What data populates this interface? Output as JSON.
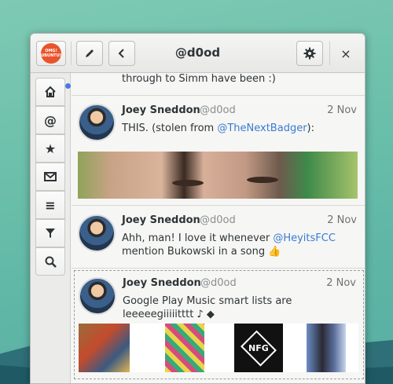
{
  "window": {
    "title": "@d0od",
    "logo_lines": [
      "OMG!",
      "UBUNTU!"
    ]
  },
  "colors": {
    "accent": "#3b7bd1",
    "logo": "#e9542b",
    "notification": "#4a79e6"
  },
  "header": {
    "icons": [
      "omg-logo",
      "compose-icon",
      "back-icon",
      "gear-icon",
      "close-icon"
    ],
    "close_label": "×"
  },
  "sidebar": {
    "items": [
      {
        "icon": "home-icon",
        "glyph": "⌂",
        "notification": true
      },
      {
        "icon": "mentions-icon",
        "glyph": "@"
      },
      {
        "icon": "favorites-icon",
        "glyph": "★"
      },
      {
        "icon": "messages-icon",
        "glyph": "✉"
      },
      {
        "icon": "lists-icon",
        "glyph": "≡"
      },
      {
        "icon": "filters-icon",
        "glyph": "⏷"
      },
      {
        "icon": "search-icon",
        "glyph": "⌕"
      }
    ]
  },
  "feed": {
    "fragment": "through to Simm have been :)",
    "tweets": [
      {
        "name": "Joey Sneddon",
        "handle": "@d0od",
        "date": "2 Nov",
        "text_before": "THIS. (stolen from ",
        "link": "@TheNextBadger",
        "text_after": "):"
      },
      {
        "name": "Joey Sneddon",
        "handle": "@d0od",
        "date": "2 Nov",
        "text_before": "Ahh, man! I love it whenever ",
        "link": "@HeyitsFCC",
        "text_after": " mention Bukowski in a song 👍"
      },
      {
        "name": "Joey Sneddon",
        "handle": "@d0od",
        "date": "2 Nov",
        "text": "Google Play Music smart lists are leeeeegiiiiitttt ♪ ◆",
        "cover_text": "NFG"
      }
    ]
  }
}
